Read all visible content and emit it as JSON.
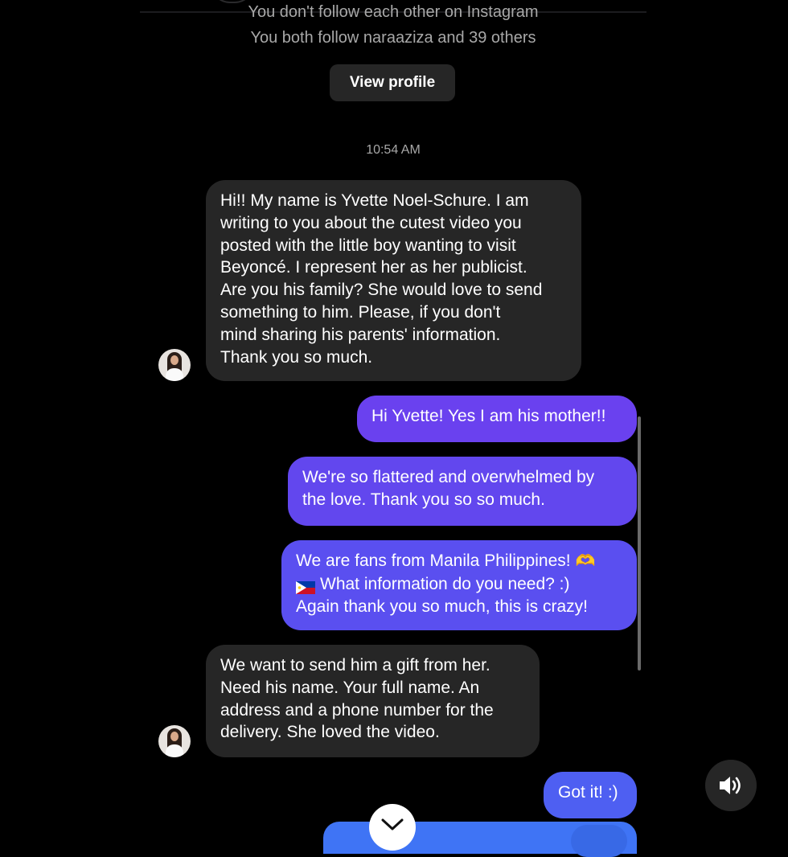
{
  "header": {
    "follow_status": "You don't follow each other on Instagram",
    "mutual_followers": "You both follow naraaziza and 39 others",
    "view_profile_label": "View profile"
  },
  "thread": {
    "timestamp": "10:54 AM",
    "messages": [
      {
        "from": "them",
        "text": "Hi!! My name is Yvette Noel-Schure. I am\nwriting to you about the cutest video you\nposted with the little boy wanting to visit\nBeyoncé. I represent her as her publicist.\nAre you his family? She would love to send\nsomething to him.  Please, if you don't\nmind sharing his parents' information.\nThank you so much."
      },
      {
        "from": "me",
        "text": "Hi Yvette! Yes I am his mother!!"
      },
      {
        "from": "me",
        "text": "We're so flattered and overwhelmed by\nthe love. Thank you so so much."
      },
      {
        "from": "me",
        "line1": "We are fans from Manila Philippines!",
        "line1_emoji": "🫶",
        "line2": "What information do you need? :)",
        "line3": "Again thank you so much, this is crazy!"
      },
      {
        "from": "them",
        "text": "We want to send him a gift from her.\nNeed his name.  Your full name.  An\naddress and a phone number for the\ndelivery.  She loved the video."
      },
      {
        "from": "me",
        "text": "Got it! :)"
      }
    ]
  },
  "controls": {
    "scroll_down_icon": "chevron-down-icon",
    "sound_icon": "speaker-on-icon"
  },
  "colors": {
    "background": "#000000",
    "incoming_bubble": "#262626",
    "outgoing_gradient_top": "#6a41ef",
    "outgoing_gradient_bottom": "#3f74f5"
  }
}
